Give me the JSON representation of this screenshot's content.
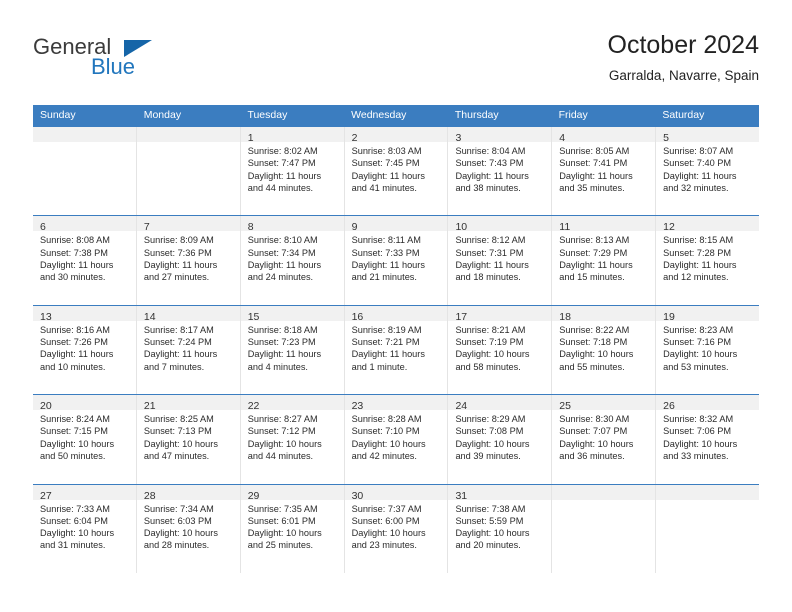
{
  "brand": {
    "name_part1": "General",
    "name_part2": "Blue"
  },
  "header": {
    "title": "October 2024",
    "subtitle": "Garralda, Navarre, Spain"
  },
  "colors": {
    "header_blue": "#3b7dc0",
    "logo_blue": "#2176bd",
    "daynum_band": "#f1f1f1",
    "cell_divider": "#e4e4e4"
  },
  "weekdays": [
    "Sunday",
    "Monday",
    "Tuesday",
    "Wednesday",
    "Thursday",
    "Friday",
    "Saturday"
  ],
  "weeks": [
    [
      {
        "day": "",
        "sunrise": "",
        "sunset": "",
        "daylight": "",
        "daylight2": ""
      },
      {
        "day": "",
        "sunrise": "",
        "sunset": "",
        "daylight": "",
        "daylight2": ""
      },
      {
        "day": "1",
        "sunrise": "Sunrise: 8:02 AM",
        "sunset": "Sunset: 7:47 PM",
        "daylight": "Daylight: 11 hours",
        "daylight2": "and 44 minutes."
      },
      {
        "day": "2",
        "sunrise": "Sunrise: 8:03 AM",
        "sunset": "Sunset: 7:45 PM",
        "daylight": "Daylight: 11 hours",
        "daylight2": "and 41 minutes."
      },
      {
        "day": "3",
        "sunrise": "Sunrise: 8:04 AM",
        "sunset": "Sunset: 7:43 PM",
        "daylight": "Daylight: 11 hours",
        "daylight2": "and 38 minutes."
      },
      {
        "day": "4",
        "sunrise": "Sunrise: 8:05 AM",
        "sunset": "Sunset: 7:41 PM",
        "daylight": "Daylight: 11 hours",
        "daylight2": "and 35 minutes."
      },
      {
        "day": "5",
        "sunrise": "Sunrise: 8:07 AM",
        "sunset": "Sunset: 7:40 PM",
        "daylight": "Daylight: 11 hours",
        "daylight2": "and 32 minutes."
      }
    ],
    [
      {
        "day": "6",
        "sunrise": "Sunrise: 8:08 AM",
        "sunset": "Sunset: 7:38 PM",
        "daylight": "Daylight: 11 hours",
        "daylight2": "and 30 minutes."
      },
      {
        "day": "7",
        "sunrise": "Sunrise: 8:09 AM",
        "sunset": "Sunset: 7:36 PM",
        "daylight": "Daylight: 11 hours",
        "daylight2": "and 27 minutes."
      },
      {
        "day": "8",
        "sunrise": "Sunrise: 8:10 AM",
        "sunset": "Sunset: 7:34 PM",
        "daylight": "Daylight: 11 hours",
        "daylight2": "and 24 minutes."
      },
      {
        "day": "9",
        "sunrise": "Sunrise: 8:11 AM",
        "sunset": "Sunset: 7:33 PM",
        "daylight": "Daylight: 11 hours",
        "daylight2": "and 21 minutes."
      },
      {
        "day": "10",
        "sunrise": "Sunrise: 8:12 AM",
        "sunset": "Sunset: 7:31 PM",
        "daylight": "Daylight: 11 hours",
        "daylight2": "and 18 minutes."
      },
      {
        "day": "11",
        "sunrise": "Sunrise: 8:13 AM",
        "sunset": "Sunset: 7:29 PM",
        "daylight": "Daylight: 11 hours",
        "daylight2": "and 15 minutes."
      },
      {
        "day": "12",
        "sunrise": "Sunrise: 8:15 AM",
        "sunset": "Sunset: 7:28 PM",
        "daylight": "Daylight: 11 hours",
        "daylight2": "and 12 minutes."
      }
    ],
    [
      {
        "day": "13",
        "sunrise": "Sunrise: 8:16 AM",
        "sunset": "Sunset: 7:26 PM",
        "daylight": "Daylight: 11 hours",
        "daylight2": "and 10 minutes."
      },
      {
        "day": "14",
        "sunrise": "Sunrise: 8:17 AM",
        "sunset": "Sunset: 7:24 PM",
        "daylight": "Daylight: 11 hours",
        "daylight2": "and 7 minutes."
      },
      {
        "day": "15",
        "sunrise": "Sunrise: 8:18 AM",
        "sunset": "Sunset: 7:23 PM",
        "daylight": "Daylight: 11 hours",
        "daylight2": "and 4 minutes."
      },
      {
        "day": "16",
        "sunrise": "Sunrise: 8:19 AM",
        "sunset": "Sunset: 7:21 PM",
        "daylight": "Daylight: 11 hours",
        "daylight2": "and 1 minute."
      },
      {
        "day": "17",
        "sunrise": "Sunrise: 8:21 AM",
        "sunset": "Sunset: 7:19 PM",
        "daylight": "Daylight: 10 hours",
        "daylight2": "and 58 minutes."
      },
      {
        "day": "18",
        "sunrise": "Sunrise: 8:22 AM",
        "sunset": "Sunset: 7:18 PM",
        "daylight": "Daylight: 10 hours",
        "daylight2": "and 55 minutes."
      },
      {
        "day": "19",
        "sunrise": "Sunrise: 8:23 AM",
        "sunset": "Sunset: 7:16 PM",
        "daylight": "Daylight: 10 hours",
        "daylight2": "and 53 minutes."
      }
    ],
    [
      {
        "day": "20",
        "sunrise": "Sunrise: 8:24 AM",
        "sunset": "Sunset: 7:15 PM",
        "daylight": "Daylight: 10 hours",
        "daylight2": "and 50 minutes."
      },
      {
        "day": "21",
        "sunrise": "Sunrise: 8:25 AM",
        "sunset": "Sunset: 7:13 PM",
        "daylight": "Daylight: 10 hours",
        "daylight2": "and 47 minutes."
      },
      {
        "day": "22",
        "sunrise": "Sunrise: 8:27 AM",
        "sunset": "Sunset: 7:12 PM",
        "daylight": "Daylight: 10 hours",
        "daylight2": "and 44 minutes."
      },
      {
        "day": "23",
        "sunrise": "Sunrise: 8:28 AM",
        "sunset": "Sunset: 7:10 PM",
        "daylight": "Daylight: 10 hours",
        "daylight2": "and 42 minutes."
      },
      {
        "day": "24",
        "sunrise": "Sunrise: 8:29 AM",
        "sunset": "Sunset: 7:08 PM",
        "daylight": "Daylight: 10 hours",
        "daylight2": "and 39 minutes."
      },
      {
        "day": "25",
        "sunrise": "Sunrise: 8:30 AM",
        "sunset": "Sunset: 7:07 PM",
        "daylight": "Daylight: 10 hours",
        "daylight2": "and 36 minutes."
      },
      {
        "day": "26",
        "sunrise": "Sunrise: 8:32 AM",
        "sunset": "Sunset: 7:06 PM",
        "daylight": "Daylight: 10 hours",
        "daylight2": "and 33 minutes."
      }
    ],
    [
      {
        "day": "27",
        "sunrise": "Sunrise: 7:33 AM",
        "sunset": "Sunset: 6:04 PM",
        "daylight": "Daylight: 10 hours",
        "daylight2": "and 31 minutes."
      },
      {
        "day": "28",
        "sunrise": "Sunrise: 7:34 AM",
        "sunset": "Sunset: 6:03 PM",
        "daylight": "Daylight: 10 hours",
        "daylight2": "and 28 minutes."
      },
      {
        "day": "29",
        "sunrise": "Sunrise: 7:35 AM",
        "sunset": "Sunset: 6:01 PM",
        "daylight": "Daylight: 10 hours",
        "daylight2": "and 25 minutes."
      },
      {
        "day": "30",
        "sunrise": "Sunrise: 7:37 AM",
        "sunset": "Sunset: 6:00 PM",
        "daylight": "Daylight: 10 hours",
        "daylight2": "and 23 minutes."
      },
      {
        "day": "31",
        "sunrise": "Sunrise: 7:38 AM",
        "sunset": "Sunset: 5:59 PM",
        "daylight": "Daylight: 10 hours",
        "daylight2": "and 20 minutes."
      },
      {
        "day": "",
        "sunrise": "",
        "sunset": "",
        "daylight": "",
        "daylight2": ""
      },
      {
        "day": "",
        "sunrise": "",
        "sunset": "",
        "daylight": "",
        "daylight2": ""
      }
    ]
  ]
}
